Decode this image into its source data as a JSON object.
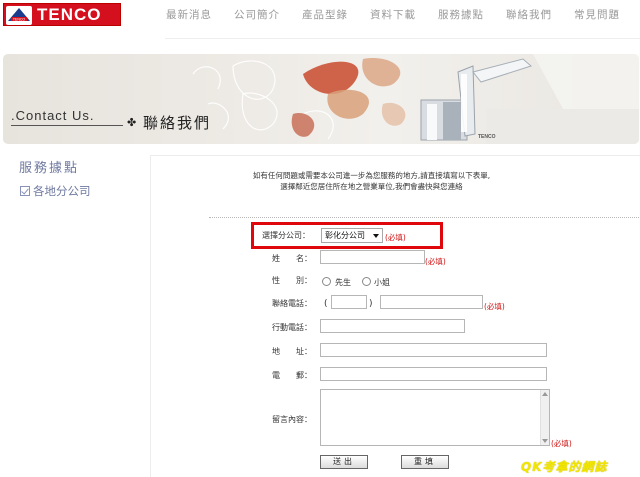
{
  "header": {
    "logo_text": "TENCO",
    "nav": [
      "最新消息",
      "公司簡介",
      "產品型錄",
      "資料下載",
      "服務據點",
      "聯絡我們",
      "常見問題"
    ]
  },
  "banner": {
    "english_title": ".Contact Us.",
    "chinese_title": "聯絡我們",
    "faucet_brand": "TENCO"
  },
  "sidebar": {
    "title": "服務據點",
    "link_label": "各地分公司"
  },
  "form": {
    "intro_line1": "如有任何問題或需要本公司進一步為您服務的地方,請直接填寫以下表單,",
    "intro_line2": "選擇鄰近您居住所在地之營業單位,我們會盡快與您連絡",
    "branch_label": "選擇分公司：",
    "branch_selected": "彰化分公司",
    "required_text": "(必填)",
    "name_label": "姓　　名：",
    "gender_label": "性　　別：",
    "gender_options": [
      "先生",
      "小姐"
    ],
    "phone_label": "聯絡電話：",
    "phone_open_paren": "(",
    "phone_close_paren": ")",
    "mobile_label": "行動電話：",
    "address_label": "地　　址：",
    "email_label": "電　　郵：",
    "message_label": "留言內容：",
    "submit_label": "送出",
    "reset_label": "重填"
  },
  "watermark": "QK考拿的網誌",
  "colors": {
    "brand_red": "#d40f1e",
    "required_red": "#d01010",
    "highlight_red": "#e0070c",
    "sidebar_blue": "#6f7aa0",
    "watermark_yellow": "#f2e600"
  }
}
